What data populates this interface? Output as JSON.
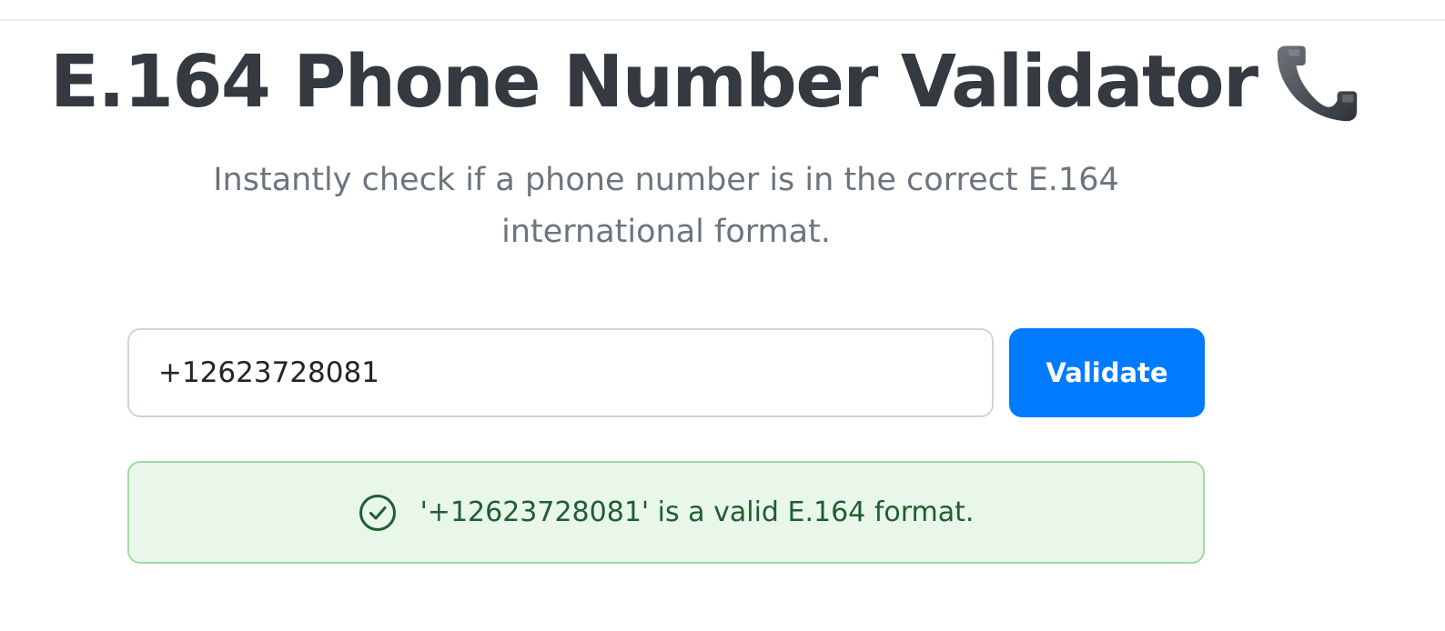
{
  "header": {
    "title": "E.164 Phone Number Validator",
    "title_icon": "telephone-receiver-icon",
    "subtitle": "Instantly check if a phone number is in the correct E.164 international format."
  },
  "form": {
    "phone_value": "+12623728081",
    "validate_label": "Validate"
  },
  "result": {
    "status": "valid",
    "icon": "check-circle-icon",
    "message": "'+12623728081' is a valid E.164 format."
  },
  "colors": {
    "title": "#343a40",
    "subtitle": "#6c757d",
    "button": "#007bff",
    "success_bg": "#e9f6ea",
    "success_border": "#a3d9a8",
    "success_text": "#1e5e2f"
  }
}
